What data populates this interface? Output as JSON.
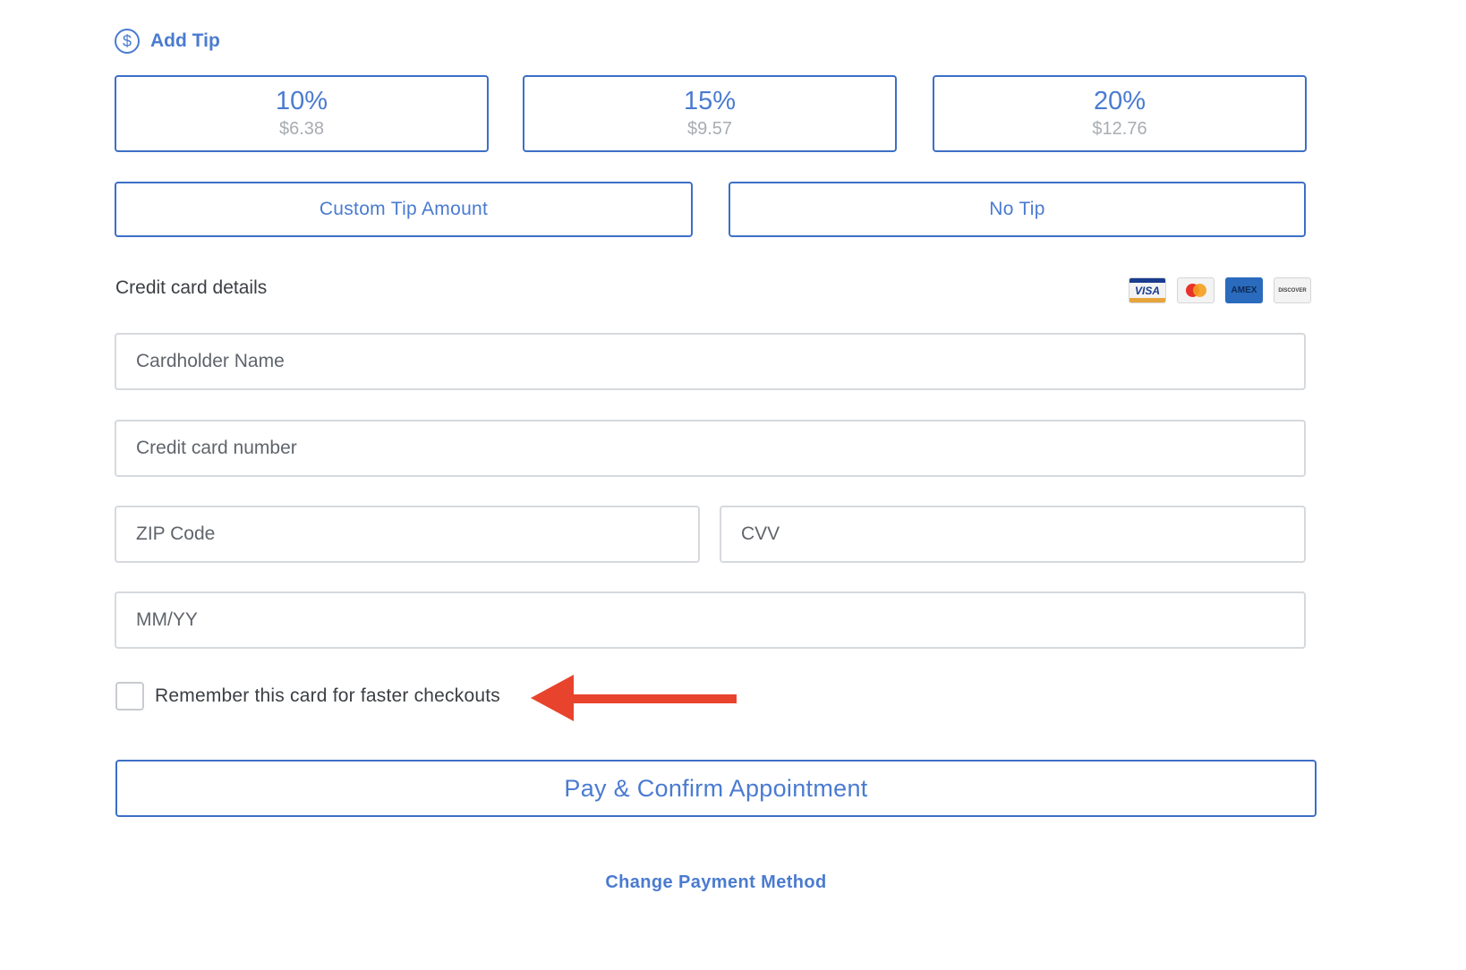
{
  "tip": {
    "title": "Add Tip",
    "icon": "dollar-circle-icon",
    "options": [
      {
        "percent": "10%",
        "amount": "$6.38"
      },
      {
        "percent": "15%",
        "amount": "$9.57"
      },
      {
        "percent": "20%",
        "amount": "$12.76"
      }
    ],
    "custom_label": "Custom Tip Amount",
    "no_tip_label": "No Tip"
  },
  "card": {
    "section_title": "Credit card details",
    "brands": [
      "VISA",
      "mastercard",
      "AMEX",
      "DISCOVER"
    ],
    "fields": {
      "name_placeholder": "Cardholder Name",
      "number_placeholder": "Credit card number",
      "zip_placeholder": "ZIP Code",
      "cvv_placeholder": "CVV",
      "expiry_placeholder": "MM/YY"
    },
    "remember_label": "Remember this card for faster checkouts",
    "remember_checked": false
  },
  "actions": {
    "pay_label": "Pay & Confirm Appointment",
    "change_method_label": "Change Payment Method"
  },
  "colors": {
    "accent": "#4a7bd0",
    "annotation_arrow": "#e8432d"
  }
}
